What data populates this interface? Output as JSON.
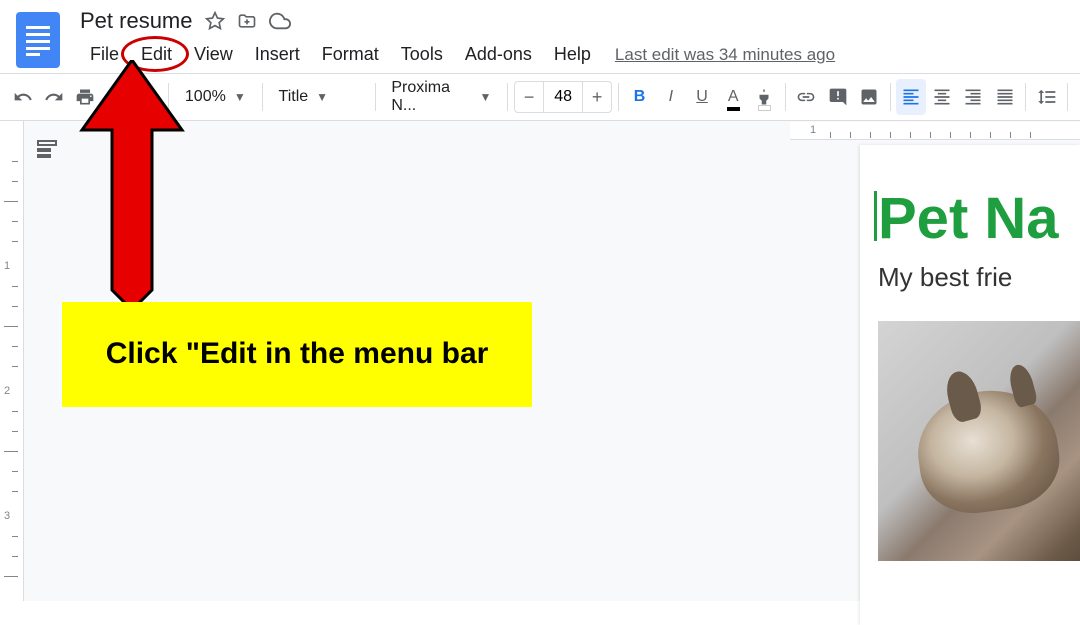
{
  "app": {
    "doc_title": "Pet resume"
  },
  "menu": {
    "file": "File",
    "edit": "Edit",
    "view": "View",
    "insert": "Insert",
    "format": "Format",
    "tools": "Tools",
    "addons": "Add-ons",
    "help": "Help",
    "last_edit": "Last edit was 34 minutes ago"
  },
  "toolbar": {
    "zoom": "100%",
    "style": "Title",
    "font": "Proxima N...",
    "font_size": "48"
  },
  "document": {
    "heading": "Pet Na",
    "subtitle": "My best frie"
  },
  "annotation": {
    "text": "Click \"Edit in the menu bar"
  },
  "ruler_h_label": "1"
}
